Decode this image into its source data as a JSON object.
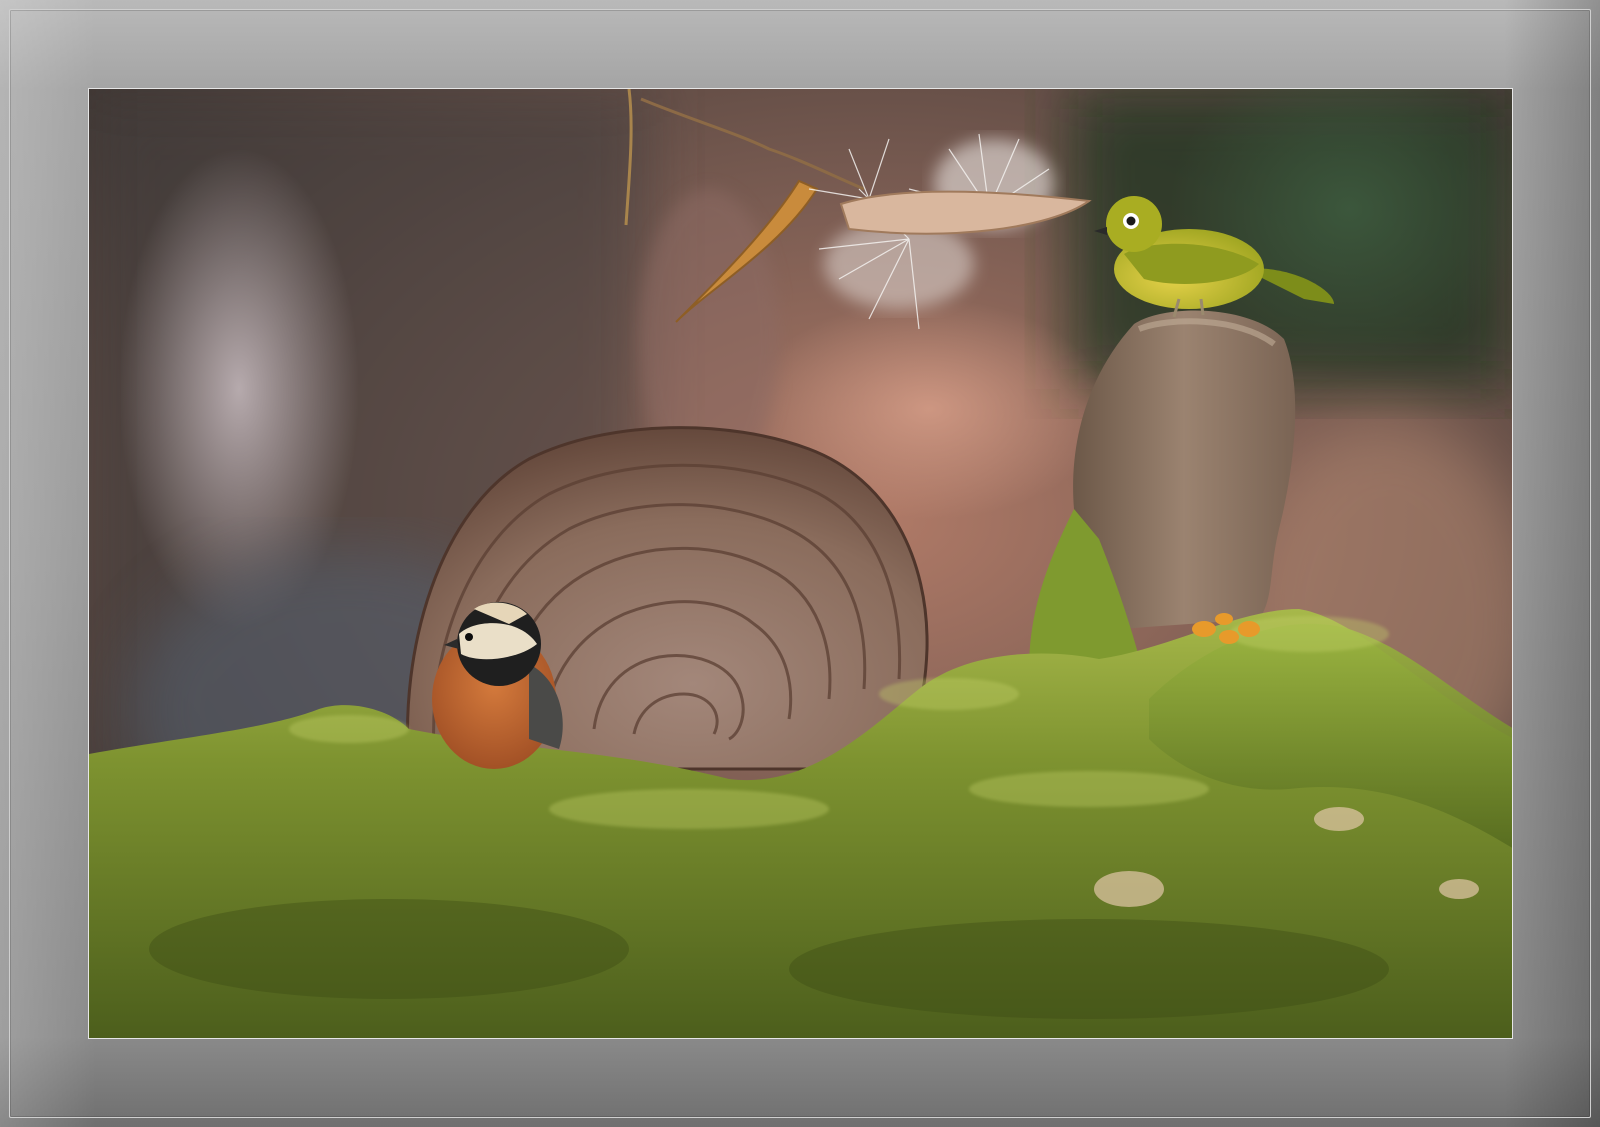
{
  "image": {
    "subject": "photograph",
    "colors": {
      "frame": "#9a9a9a",
      "moss": "#7a8f2e",
      "bracket_fungus": "#8a6e5e",
      "white_eye_bird": "#a9ad22",
      "tit_bird_belly": "#c06a33"
    }
  }
}
